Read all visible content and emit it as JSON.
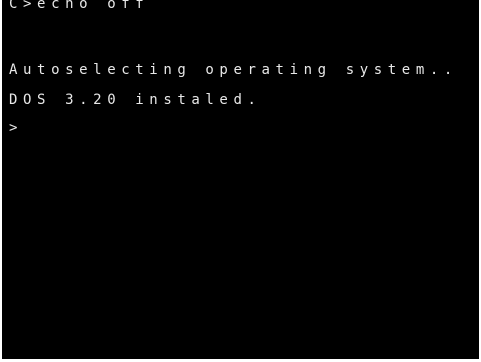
{
  "terminal": {
    "lines": [
      "C>echo off",
      "Autoselecting operating system..",
      "DOS 3.20 instaled.",
      ">"
    ],
    "background_color": "#000000",
    "text_color": "#e8e8e8"
  }
}
